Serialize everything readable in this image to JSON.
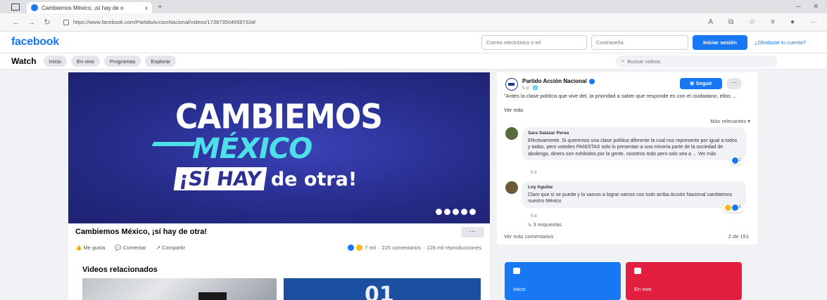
{
  "browser": {
    "tab_title": "Cambiemos México, ¡sí hay de o",
    "tab_close": "x",
    "new_tab": "+",
    "url": "https://www.facebook.com/PartidoAccionNacional/videos/1738735046587334/"
  },
  "header": {
    "logo": "facebook",
    "email_placeholder": "Correo electrónico o tel",
    "password_placeholder": "Contraseña",
    "login_label": "Iniciar sesión",
    "forgot_label": "¿Olvidaste tu cuenta?"
  },
  "watch": {
    "title": "Watch",
    "tabs": [
      "Inicio",
      "En vivo",
      "Programas",
      "Explorar"
    ],
    "search_placeholder": "Buscar videos"
  },
  "video": {
    "line1": "CAMBIEMOS",
    "line2": "MÉXICO",
    "line3_hay": "¡SÍ HAY",
    "line3_otra": "de otra!",
    "title": "Cambiemos México, ¡sí hay de otra!",
    "more": "···",
    "actions": [
      "Me gusta",
      "Comentar",
      "Compartir"
    ],
    "reactions_count": "7 mil",
    "comments": "225 comentarios",
    "views": "128 mil reproducciones"
  },
  "page": {
    "name": "Partido Acción Nacional",
    "meta": "5 d · 🌐",
    "follow_label": "Seguir",
    "more": "···",
    "post_text": "\"Antes la clase política que vive del, la prioridad a saber que responde es con el ciudadano, ellos ...",
    "see_more": "Ver más",
    "sort_label": "Más relevantes ▾"
  },
  "comments": [
    {
      "name": "Sara Salazar Perea",
      "text": "Efectivamente. Si queremos una clase política diferente la cual nos represente por igual a todos y todas, pero ustedes PANISTAS solo lo presentan a una minoría parte de la sociedad de abolengo, dinero son exhibidos por la gente, nosotros todo pero solo sea a ... Ver más",
      "time": "5 d",
      "reacts": "3"
    },
    {
      "name": "Loy Aguilar",
      "text": "Claro que sí se puede y lo vamos a lograr vamos con todo arriba Acción Nacional cambiemos nuestro México",
      "time": "5 d",
      "reacts": "5"
    }
  ],
  "replies": "↳ 3 respuestas",
  "more_comments": "Ver más comentarios",
  "comment_count": "2 de 151",
  "related": {
    "title": "Videos relacionados",
    "thumb_number": "01"
  },
  "tiles": [
    {
      "label": "Inicio"
    },
    {
      "label": "En vivo"
    }
  ]
}
